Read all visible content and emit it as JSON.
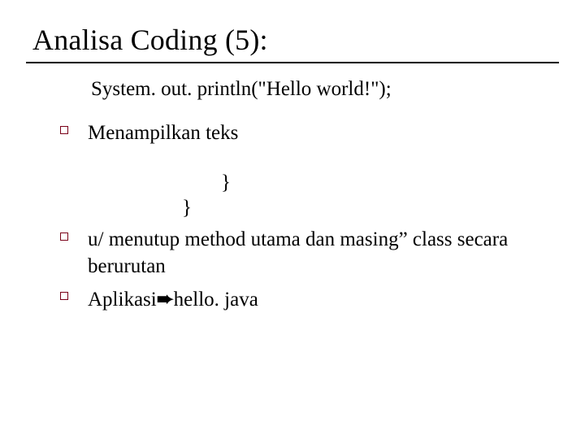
{
  "title": "Analisa Coding (5):",
  "code_line": "System. out. println(\"Hello world!\");",
  "bullets": {
    "b1": "Menampilkan teks",
    "brace1": "}",
    "brace2": "}",
    "b2": "u/ menutup method utama dan masing” class secara berurutan",
    "b3_pre": "Aplikasi",
    "b3_arrow": "➨",
    "b3_post": "hello. java"
  }
}
